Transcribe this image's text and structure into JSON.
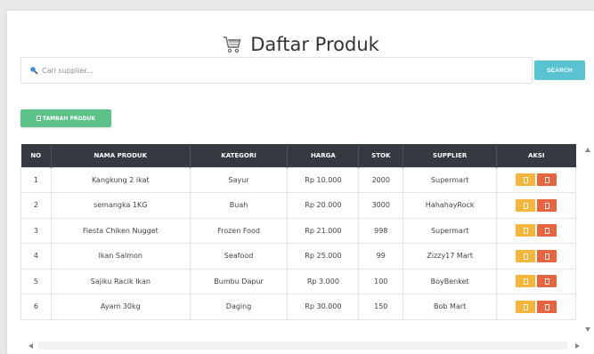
{
  "header": {
    "title": "Daftar Produk",
    "icon": "shopping-cart-icon"
  },
  "search": {
    "placeholder": "Cari supplier...",
    "value": "",
    "button_label": "SEARCH",
    "icon": "search-icon"
  },
  "actions": {
    "add_label": "TAMBAH PRODUK"
  },
  "table": {
    "columns": [
      "NO",
      "NAMA PRODUK",
      "KATEGORI",
      "HARGA",
      "STOK",
      "SUPPLIER",
      "AKSI"
    ],
    "rows": [
      {
        "no": "1",
        "nama": "Kangkung 2 ikat",
        "kategori": "Sayur",
        "harga": "Rp 10.000",
        "stok": "2000",
        "supplier": "Supermart"
      },
      {
        "no": "2",
        "nama": "semangka 1KG",
        "kategori": "Buah",
        "harga": "Rp 20.000",
        "stok": "3000",
        "supplier": "HahahayRock"
      },
      {
        "no": "3",
        "nama": "Fiesta Chiken Nugget",
        "kategori": "Frozen Food",
        "harga": "Rp 21.000",
        "stok": "998",
        "supplier": "Supermart"
      },
      {
        "no": "4",
        "nama": "Ikan Salmon",
        "kategori": "Seafood",
        "harga": "Rp 25.000",
        "stok": "99",
        "supplier": "Zizzy17 Mart"
      },
      {
        "no": "5",
        "nama": "Sajiku Racik Ikan",
        "kategori": "Bumbu Dapur",
        "harga": "Rp 3.000",
        "stok": "100",
        "supplier": "BoyBenket"
      },
      {
        "no": "6",
        "nama": "Ayam 30kg",
        "kategori": "Daging",
        "harga": "Rp 30.000",
        "stok": "150",
        "supplier": "Bob Mart"
      }
    ]
  },
  "colors": {
    "search_button": "#59c3d1",
    "add_button": "#5cc28a",
    "table_header": "#343a40",
    "edit_button": "#f5b63b",
    "delete_button": "#e8633f"
  }
}
